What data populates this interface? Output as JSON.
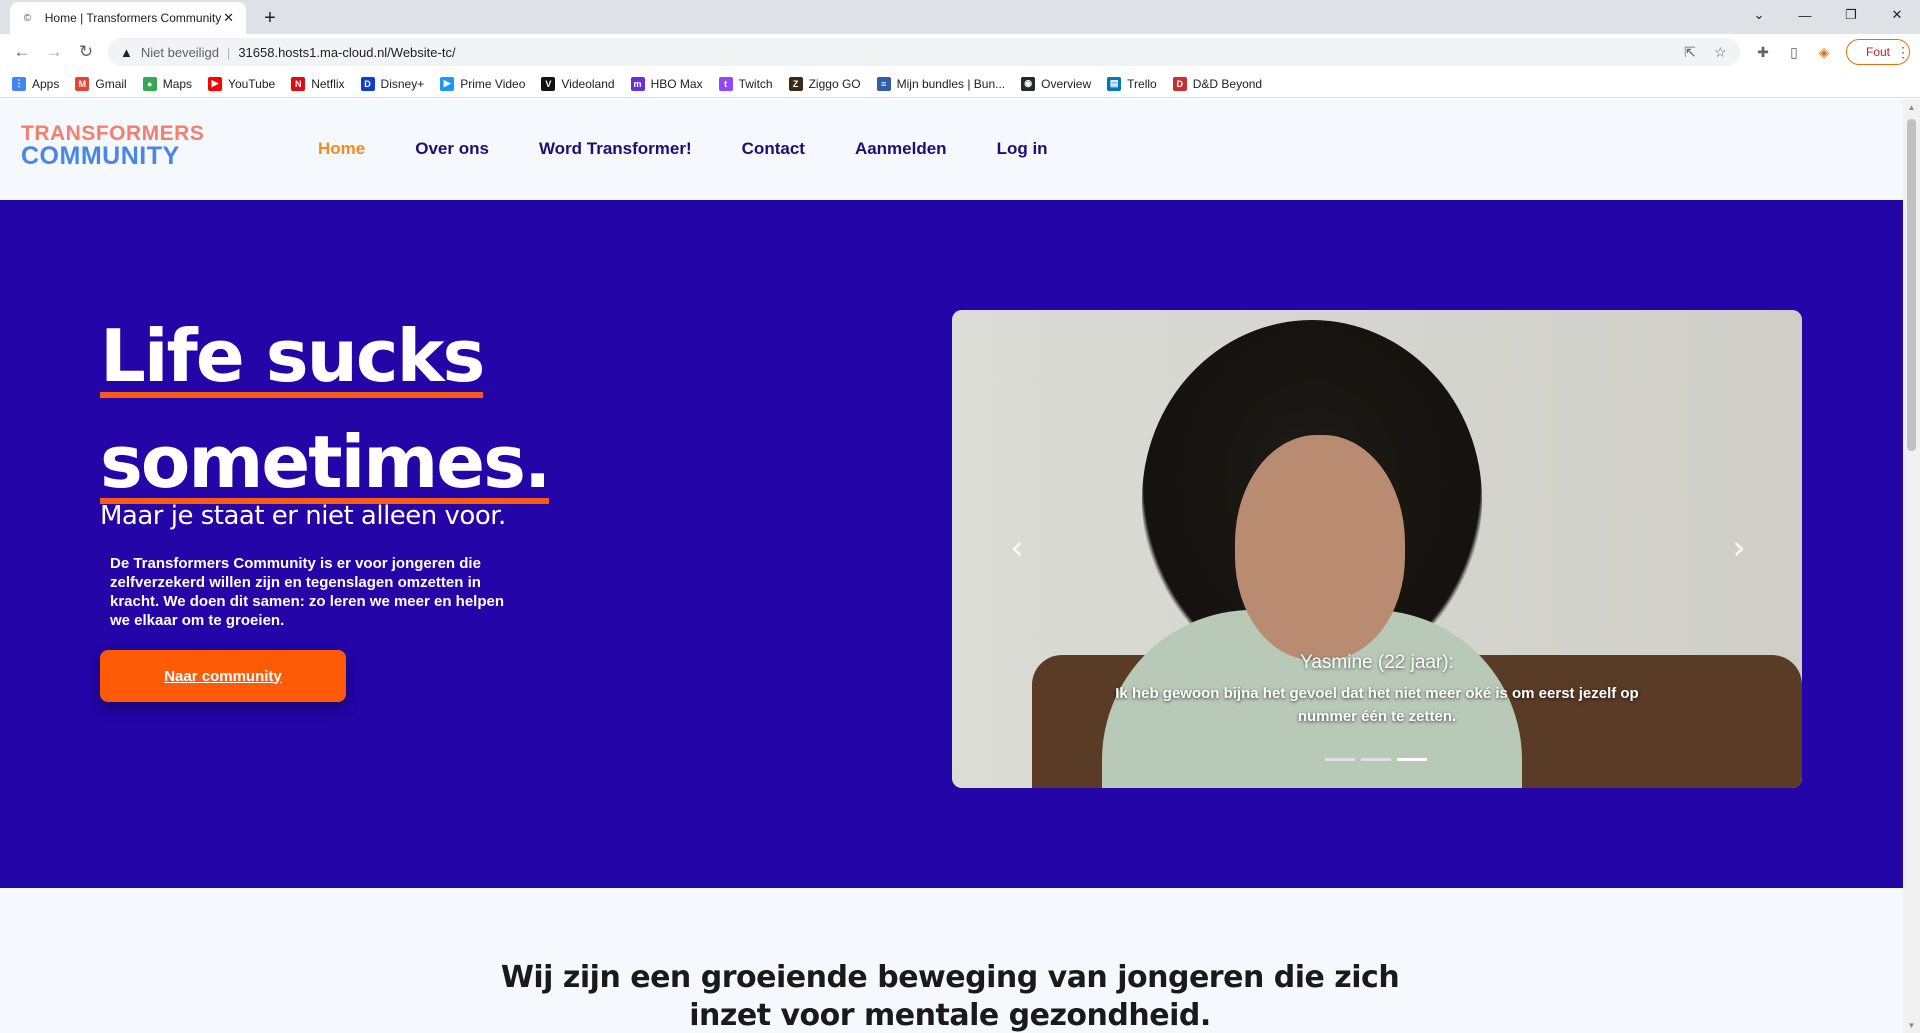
{
  "browser": {
    "tab_title": "Home | Transformers Community",
    "tab_close": "✕",
    "new_tab": "+",
    "security_label": "Niet beveiligd",
    "url": "31658.hosts1.ma-cloud.nl/Website-tc/",
    "profile_label": "Fout",
    "bookmarks": [
      {
        "label": "Apps",
        "icon": "apps-grid-icon",
        "color": "#4285f4"
      },
      {
        "label": "Gmail",
        "icon": "gmail-icon",
        "color": "#ea4335"
      },
      {
        "label": "Maps",
        "icon": "maps-icon",
        "color": "#34a853"
      },
      {
        "label": "YouTube",
        "icon": "youtube-icon",
        "color": "#ff0000"
      },
      {
        "label": "Netflix",
        "icon": "netflix-icon",
        "color": "#e50914"
      },
      {
        "label": "Disney+",
        "icon": "disney-icon",
        "color": "#113ccf"
      },
      {
        "label": "Prime Video",
        "icon": "prime-video-icon",
        "color": "#1a98ff"
      },
      {
        "label": "Videoland",
        "icon": "videoland-icon",
        "color": "#111111"
      },
      {
        "label": "HBO Max",
        "icon": "hbo-max-icon",
        "color": "#6b2fd6"
      },
      {
        "label": "Twitch",
        "icon": "twitch-icon",
        "color": "#9146ff"
      },
      {
        "label": "Ziggo GO",
        "icon": "ziggo-go-icon",
        "color": "#3b2a14"
      },
      {
        "label": "Mijn bundles | Bun...",
        "icon": "bundles-icon",
        "color": "#2f5fa8"
      },
      {
        "label": "Overview",
        "icon": "github-icon",
        "color": "#24292e"
      },
      {
        "label": "Trello",
        "icon": "trello-icon",
        "color": "#0079bf"
      },
      {
        "label": "D&D Beyond",
        "icon": "dnd-beyond-icon",
        "color": "#c53131"
      }
    ]
  },
  "site": {
    "logo_line1": "TRANSFORMERS",
    "logo_line2": "COMMUNITY",
    "nav": [
      {
        "label": "Home",
        "active": true
      },
      {
        "label": "Over ons",
        "active": false
      },
      {
        "label": "Word Transformer!",
        "active": false
      },
      {
        "label": "Contact",
        "active": false
      },
      {
        "label": "Aanmelden",
        "active": false
      },
      {
        "label": "Log in",
        "active": false
      }
    ],
    "colors": {
      "hero_bg": "#2305a8",
      "accent": "#ff5a06",
      "nav_text": "#1f0e76",
      "nav_active": "#f28c1c"
    }
  },
  "hero": {
    "headline_line1": "Life sucks",
    "headline_line2": "sometimes.",
    "subheadline": "Maar je staat er niet alleen voor.",
    "body": "De Transformers Community is er voor jongeren die zelfverzekerd willen zijn en tegenslagen omzetten in kracht. We doen dit samen: zo leren we meer en helpen we elkaar om te groeien.",
    "cta_label": "Naar community"
  },
  "carousel": {
    "caption_name": "Yasmine (22 jaar):",
    "caption_quote": "Ik heb gewoon bijna het gevoel dat het niet meer oké is om eerst jezelf op nummer één te zetten.",
    "prev_icon": "‹",
    "next_icon": "›",
    "slide_count": 3,
    "active_slide": 3
  },
  "section2": {
    "title": "Wij zijn een groeiende beweging van jongeren die zich inzet voor mentale gezondheid."
  }
}
